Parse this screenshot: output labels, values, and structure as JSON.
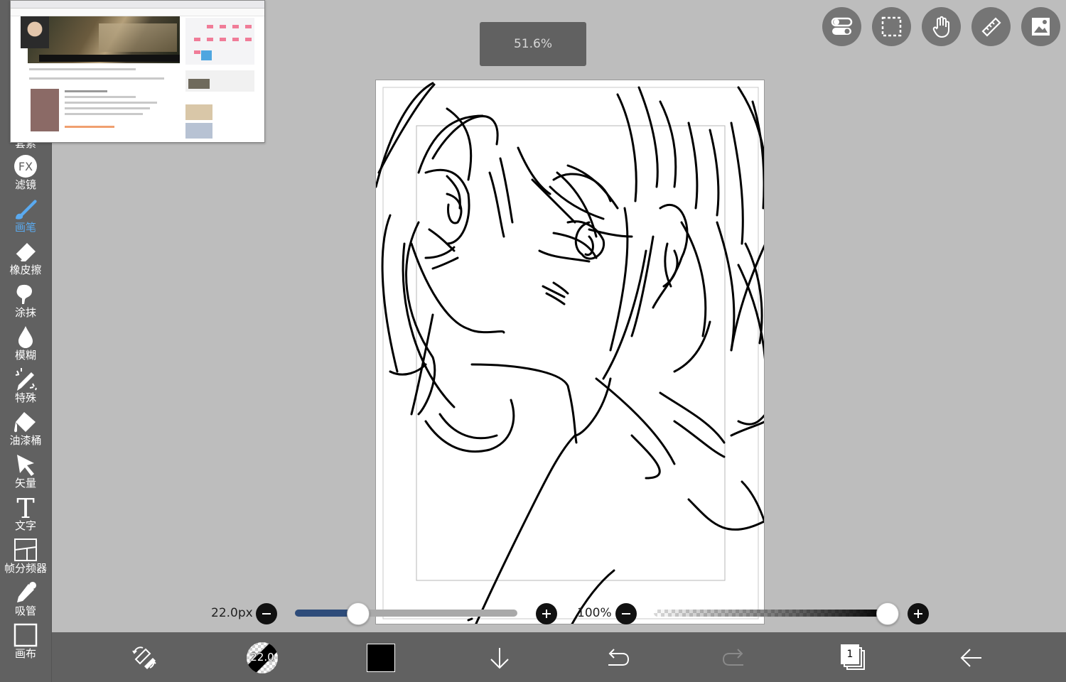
{
  "tools": [
    {
      "label": "套索",
      "icon": "lasso-icon"
    },
    {
      "label": "滤镜",
      "icon": "fx-icon"
    },
    {
      "label": "画笔",
      "icon": "brush-icon"
    },
    {
      "label": "橡皮擦",
      "icon": "eraser-icon"
    },
    {
      "label": "涂抹",
      "icon": "smudge-icon"
    },
    {
      "label": "模糊",
      "icon": "blur-drop-icon"
    },
    {
      "label": "特殊",
      "icon": "special-pen-icon"
    },
    {
      "label": "油漆桶",
      "icon": "paint-bucket-icon"
    },
    {
      "label": "矢量",
      "icon": "vector-arrow-icon"
    },
    {
      "label": "文字",
      "icon": "text-t-icon"
    },
    {
      "label": "帧分频器",
      "icon": "frame-divider-icon"
    },
    {
      "label": "吸管",
      "icon": "eyedropper-icon"
    },
    {
      "label": "画布",
      "icon": "canvas-square-icon"
    }
  ],
  "active_tool": "画笔",
  "zoom": "51.6%",
  "top_buttons": [
    "toggle-icon",
    "selection-icon",
    "hand-icon",
    "ruler-icon",
    "image-icon"
  ],
  "brush": {
    "size_label": "22.0px",
    "size_fraction": 0.28,
    "preview_label": "22.0"
  },
  "opacity": {
    "label": "100%",
    "fraction": 1.0
  },
  "color": "#000000",
  "accent": "#5aaaf0",
  "layer_count": "1",
  "bottom_icons": [
    "swap-icon",
    "brush-preview",
    "color-swatch",
    "download-icon",
    "undo-icon",
    "redo-icon",
    "layers-icon",
    "back-arrow-icon"
  ]
}
